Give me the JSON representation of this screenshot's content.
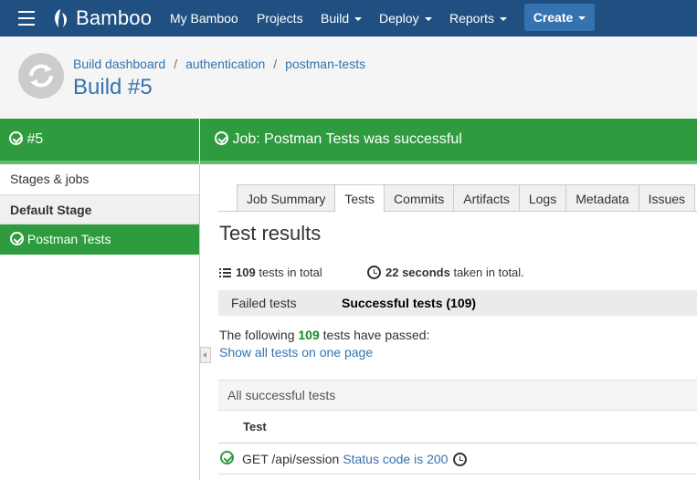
{
  "app": {
    "name": "Bamboo"
  },
  "nav": {
    "items": [
      "My Bamboo",
      "Projects",
      "Build",
      "Deploy",
      "Reports"
    ],
    "create_label": "Create"
  },
  "breadcrumb": {
    "items": [
      "Build dashboard",
      "authentication",
      "postman-tests"
    ]
  },
  "build": {
    "title": "Build #5",
    "number_label": "#5"
  },
  "job_status": "Job: Postman Tests was successful",
  "sidebar": {
    "stages_label": "Stages & jobs",
    "stage_name": "Default Stage",
    "job_name": "Postman Tests"
  },
  "tabs": [
    "Job Summary",
    "Tests",
    "Commits",
    "Artifacts",
    "Logs",
    "Metadata",
    "Issues"
  ],
  "active_tab": "Tests",
  "results": {
    "heading": "Test results",
    "total_count": "109",
    "total_suffix": "tests in total",
    "duration": "22 seconds",
    "duration_suffix": "taken in total.",
    "filter_failed": "Failed tests",
    "filter_successful": "Successful tests (109)",
    "passed_prefix": "The following",
    "passed_count": "109",
    "passed_suffix": "tests have passed:",
    "show_all_link": "Show all tests on one page",
    "section_title": "All successful tests",
    "column_test": "Test",
    "rows": [
      {
        "name": "GET /api/session",
        "detail": "Status code is 200"
      }
    ]
  },
  "colors": {
    "topbar": "#205081",
    "accent_blue": "#3572b0",
    "success_green": "#2e9b3f",
    "count_green": "#14892c"
  },
  "icons": [
    "menu-icon",
    "bamboo-logo-icon",
    "check-circle-icon",
    "list-icon",
    "clock-icon",
    "collapse-arrow-icon",
    "chevron-down-icon"
  ]
}
